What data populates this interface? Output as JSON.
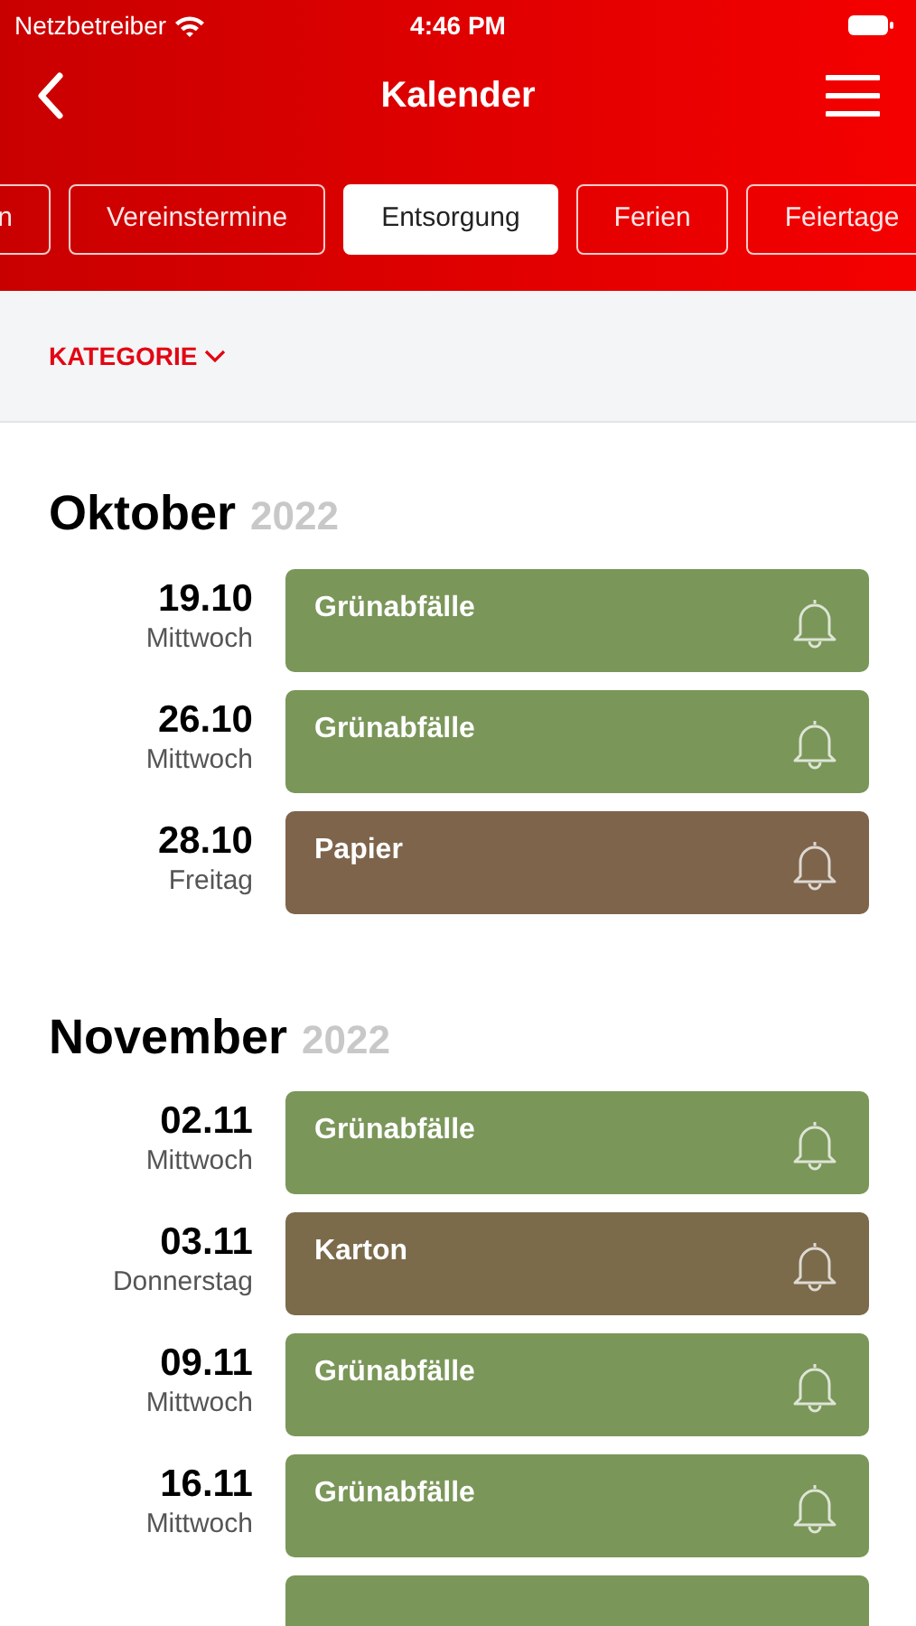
{
  "status_bar": {
    "carrier": "Netzbetreiber",
    "time": "4:46 PM"
  },
  "nav": {
    "title": "Kalender"
  },
  "tabs": [
    {
      "label": "n",
      "selected": false
    },
    {
      "label": "Vereinstermine",
      "selected": false
    },
    {
      "label": "Entsorgung",
      "selected": true
    },
    {
      "label": "Ferien",
      "selected": false
    },
    {
      "label": "Feiertage",
      "selected": false
    }
  ],
  "filter": {
    "label": "KATEGORIE"
  },
  "months": [
    {
      "name": "Oktober",
      "year": "2022",
      "events": [
        {
          "date": "19.10",
          "weekday": "Mittwoch",
          "title": "Grünabfälle",
          "color": "#7a9659"
        },
        {
          "date": "26.10",
          "weekday": "Mittwoch",
          "title": "Grünabfälle",
          "color": "#7a9659"
        },
        {
          "date": "28.10",
          "weekday": "Freitag",
          "title": "Papier",
          "color": "#7e644b"
        }
      ]
    },
    {
      "name": "November",
      "year": "2022",
      "events": [
        {
          "date": "02.11",
          "weekday": "Mittwoch",
          "title": "Grünabfälle",
          "color": "#7a9659"
        },
        {
          "date": "03.11",
          "weekday": "Donnerstag",
          "title": "Karton",
          "color": "#7b6b4b"
        },
        {
          "date": "09.11",
          "weekday": "Mittwoch",
          "title": "Grünabfälle",
          "color": "#7a9659"
        },
        {
          "date": "16.11",
          "weekday": "Mittwoch",
          "title": "Grünabfälle",
          "color": "#7a9659"
        },
        {
          "color": "#7a9659"
        }
      ]
    }
  ]
}
